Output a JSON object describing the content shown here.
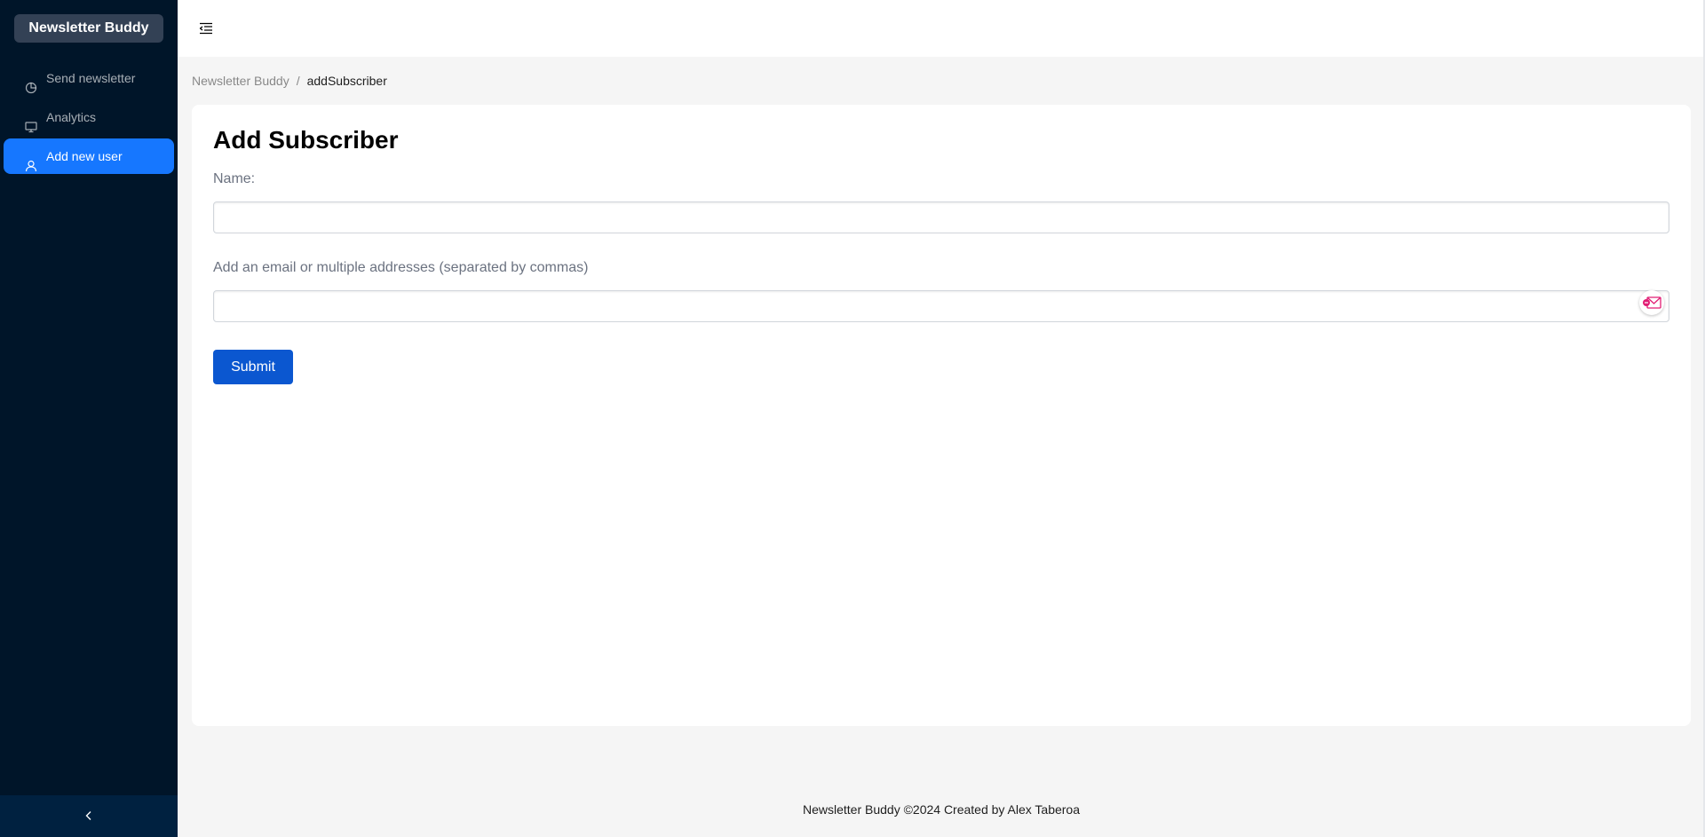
{
  "sidebar": {
    "brand": "Newsletter Buddy",
    "items": [
      {
        "label": "Send newsletter",
        "icon": "pie-chart-icon",
        "active": false
      },
      {
        "label": "Analytics",
        "icon": "desktop-icon",
        "active": false
      },
      {
        "label": "Add new user",
        "icon": "user-icon",
        "active": true
      }
    ],
    "collapse_icon": "chevron-left-icon"
  },
  "header": {
    "toggle_icon": "menu-fold-icon"
  },
  "breadcrumb": {
    "root": "Newsletter Buddy",
    "separator": "/",
    "current": "addSubscriber"
  },
  "form": {
    "title": "Add Subscriber",
    "name_label": "Name:",
    "name_value": "",
    "email_label": "Add an email or multiple addresses (separated by commas)",
    "email_value": "",
    "email_extension_icon": "email-extension-icon",
    "submit_label": "Submit"
  },
  "footer": {
    "text": "Newsletter Buddy ©2024 Created by Alex Taberoa"
  },
  "colors": {
    "sidebar_bg": "#001529",
    "active_item": "#1677ff",
    "submit_button": "#0b57d0"
  }
}
